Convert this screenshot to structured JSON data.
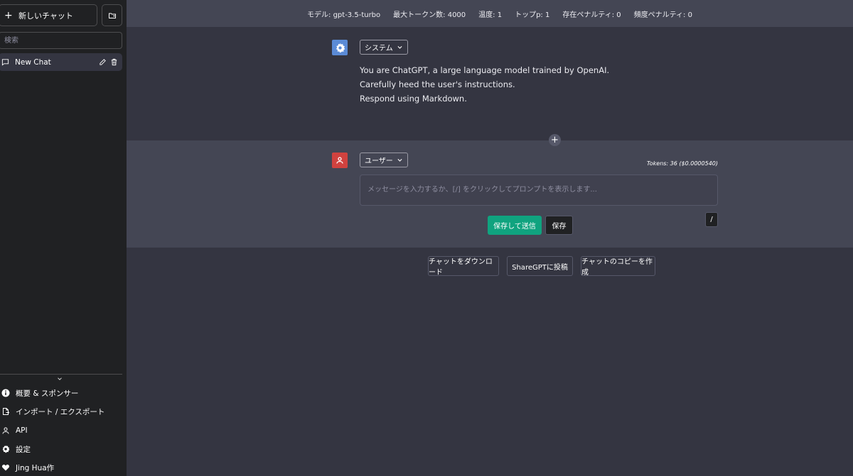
{
  "sidebar": {
    "new_chat_label": "新しいチャット",
    "search_placeholder": "検索",
    "chat_item_label": "New Chat",
    "menu": [
      {
        "label": "概要 & スポンサー",
        "icon": "info-icon"
      },
      {
        "label": "インポート / エクスポート",
        "icon": "file-export-icon"
      },
      {
        "label": "API",
        "icon": "person-icon"
      },
      {
        "label": "設定",
        "icon": "gear-icon"
      },
      {
        "label": "Jing Hua作",
        "icon": "heart-icon"
      }
    ]
  },
  "topbar": {
    "model": "モデル: gpt-3.5-turbo",
    "max_tokens": "最大トークン数: 4000",
    "temperature": "温度: 1",
    "top_p": "トップp: 1",
    "presence_penalty": "存在ペナルティ: 0",
    "frequency_penalty": "頻度ペナルティ: 0"
  },
  "system_message": {
    "role_label": "システム",
    "lines": [
      "You are ChatGPT, a large language model trained by OpenAI.",
      "Carefully heed the user's instructions.",
      "Respond using Markdown."
    ]
  },
  "user_message": {
    "role_label": "ユーザー",
    "tokens": "Tokens: 36 ($0.0000540)",
    "input_placeholder": "メッセージを入力するか、[/] をクリックしてプロンプトを表示します...",
    "input_value": "",
    "slash_label": "/",
    "save_send_label": "保存して送信",
    "save_label": "保存"
  },
  "bottom_actions": {
    "download_label": "チャットをダウンロード",
    "share_label": "ShareGPTに投稿",
    "copy_label": "チャットのコピーを作成"
  },
  "colors": {
    "sidebar_bg": "#202123",
    "main_bg": "#343541",
    "panel_bg": "#444654",
    "accent_green": "#10a37f",
    "system_avatar": "#5b8bd6",
    "user_avatar": "#d0423f"
  }
}
